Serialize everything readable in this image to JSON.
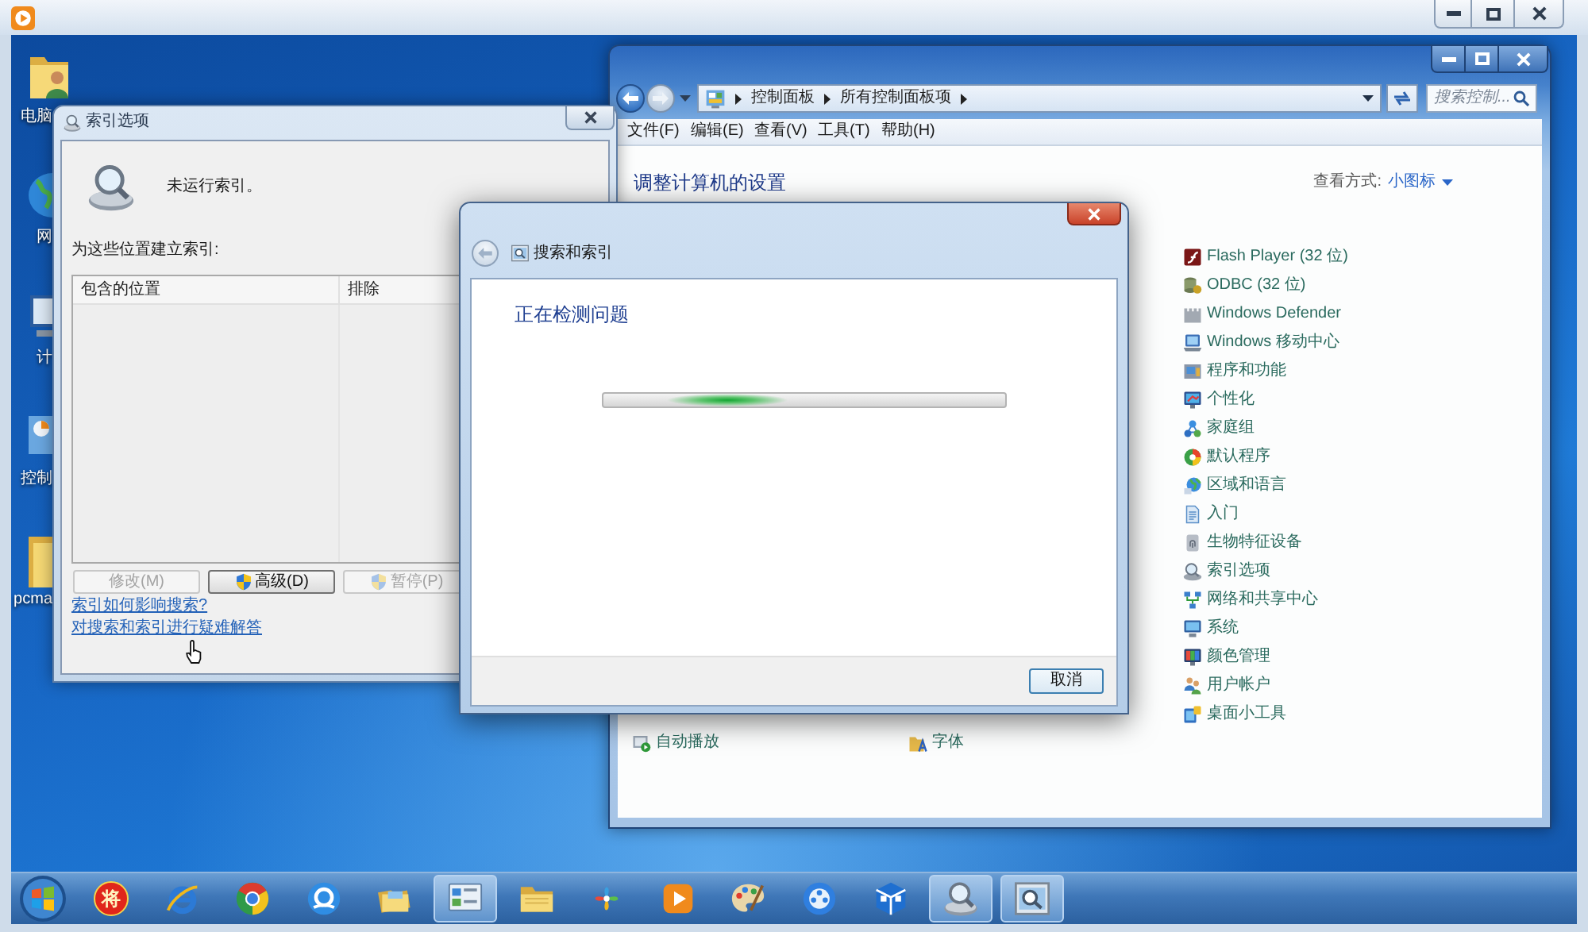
{
  "desktop_icons": [
    {
      "label": "电脑"
    },
    {
      "label": "网"
    },
    {
      "label": "计"
    },
    {
      "label": "控制"
    },
    {
      "label": "pcma"
    }
  ],
  "control_panel": {
    "address": [
      "控制面板",
      "所有控制面板项"
    ],
    "search": {
      "placeholder": "搜索控制..."
    },
    "menu": [
      "文件(F)",
      "编辑(E)",
      "查看(V)",
      "工具(T)",
      "帮助(H)"
    ],
    "heading": "调整计算机的设置",
    "view_by": {
      "label": "查看方式:",
      "value": "小图标"
    },
    "columns": [
      {
        "items": [
          "自动播放"
        ]
      },
      {
        "items": [
          "字体"
        ]
      },
      {
        "items": [
          "Flash Player (32 位)",
          "ODBC (32 位)",
          "Windows Defender",
          "Windows 移动中心",
          "程序和功能",
          "个性化",
          "家庭组",
          "默认程序",
          "区域和语言",
          "入门",
          "生物特征设备",
          "索引选项",
          "网络和共享中心",
          "系统",
          "颜色管理",
          "用户帐户",
          "桌面小工具"
        ]
      }
    ]
  },
  "index_options": {
    "title": "索引选项",
    "status": "未运行索引。",
    "locations_label": "为这些位置建立索引:",
    "columns": [
      "包含的位置",
      "排除"
    ],
    "buttons": [
      {
        "label": "修改(M)",
        "kind": "plain",
        "disabled": true
      },
      {
        "label": "高级(D)",
        "kind": "shield",
        "disabled": false
      },
      {
        "label": "暂停(P)",
        "kind": "shield",
        "disabled": true
      }
    ],
    "links": [
      "索引如何影响搜索?",
      "对搜索和索引进行疑难解答"
    ]
  },
  "dialog": {
    "title": "搜索和索引",
    "heading": "正在检测问题",
    "progress": {
      "indeterminate": true
    },
    "buttons": [
      "取消"
    ]
  },
  "taskbar": {
    "buttons": [
      {
        "label": "将",
        "active": false
      },
      {
        "active": false
      },
      {
        "active": false
      },
      {
        "active": false
      },
      {
        "active": false
      },
      {
        "active": true
      },
      {
        "active": false
      },
      {
        "active": false
      },
      {
        "active": false
      },
      {
        "active": false
      },
      {
        "active": false
      },
      {
        "active": false
      },
      {
        "active": true
      },
      {
        "active": true
      }
    ]
  }
}
